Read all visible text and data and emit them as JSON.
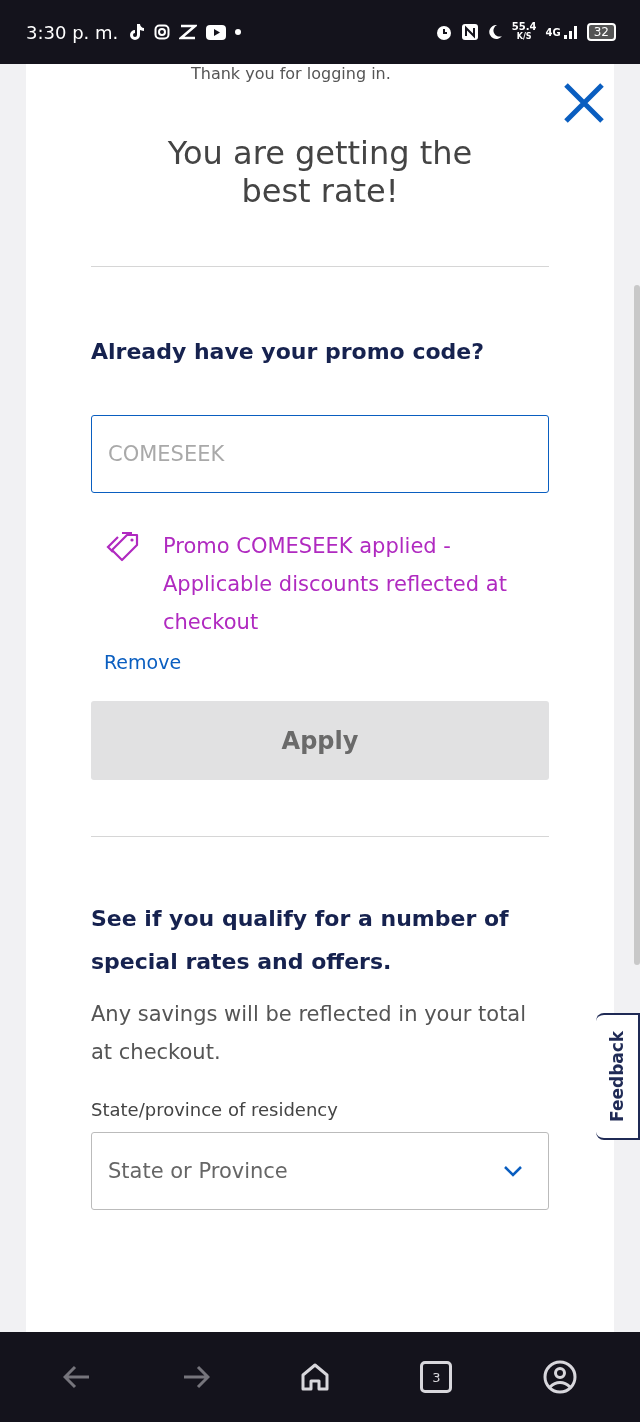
{
  "status_bar": {
    "time": "3:30 p. m.",
    "speed": "55.4",
    "speed_unit": "K/S",
    "network": "4G",
    "battery": "32"
  },
  "modal": {
    "intro": "Thank you for logging in.",
    "title": "You are getting the best rate!",
    "promo": {
      "heading": "Already have your promo code?",
      "field": {
        "value": "COMESEEK",
        "disabled": true
      },
      "message": "Promo COMESEEK applied - Applicable discounts reflected at checkout",
      "remove_link": "Remove",
      "apply_button": {
        "label": "Apply",
        "disabled": true
      }
    },
    "offers": {
      "heading": "See if you qualify for a number of special rates and offers.",
      "text": "Any savings will be reflected in your total at checkout.",
      "state_label": "State/province of residency",
      "state_select": {
        "placeholder": "State or Province"
      }
    }
  },
  "feedback_tab": "Feedback",
  "browser_nav": {
    "tabs_count": "3"
  }
}
